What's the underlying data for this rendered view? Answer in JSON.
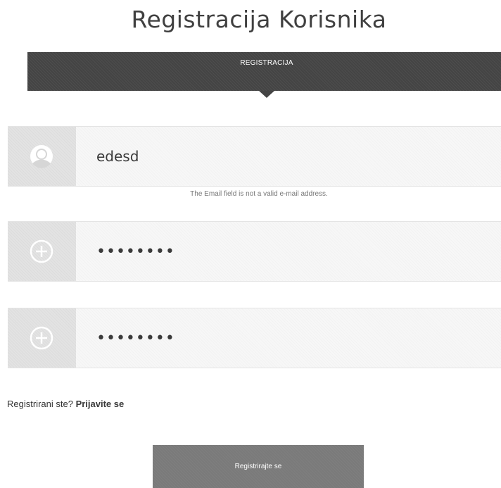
{
  "header": {
    "title": "Registracija Korisnika"
  },
  "tabs": [
    {
      "label": "REGISTRACIJA",
      "active": true
    }
  ],
  "form": {
    "email": {
      "icon": "user-icon",
      "value": "edesd",
      "validation": "The Email field is not a valid e-mail address."
    },
    "password": {
      "icon": "plus-circle-icon",
      "value": "passw0rd"
    },
    "confirm_password": {
      "icon": "plus-circle-icon",
      "value": "passw0rd"
    }
  },
  "login_prompt": {
    "text": "Registrirani ste?",
    "link": "Prijavite se"
  },
  "submit": {
    "label": "Registrirajte se"
  },
  "colors": {
    "tab_bar": "#444444",
    "icon_box": "#e3e3e3",
    "field_bg": "#f7f7f7",
    "button": "#7a7a7a"
  }
}
